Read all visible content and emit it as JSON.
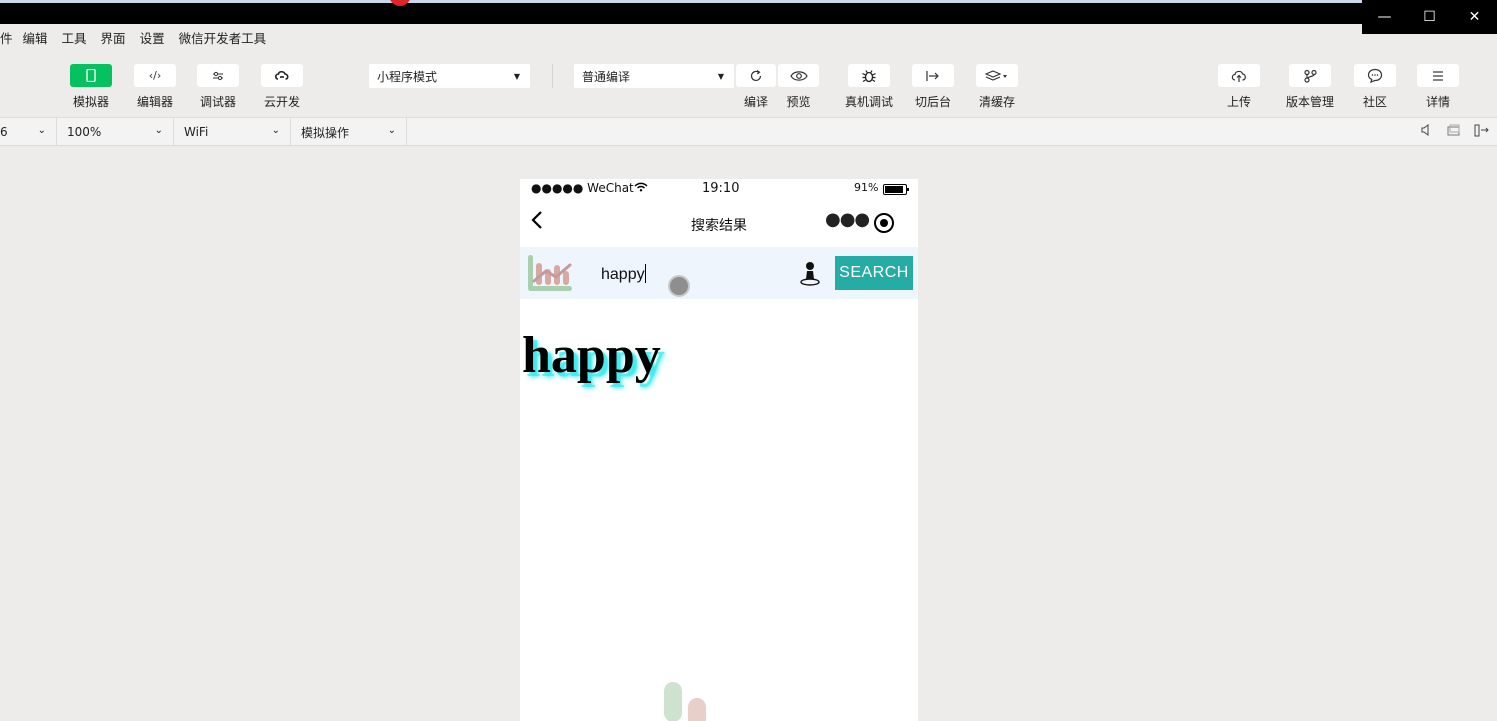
{
  "window": {
    "minimize_glyph": "—",
    "maximize_glyph": "☐",
    "close_glyph": "✕"
  },
  "menu": [
    "件",
    "编辑",
    "工具",
    "界面",
    "设置",
    "微信开发者工具"
  ],
  "toolbar": {
    "simulator": "模拟器",
    "editor": "编辑器",
    "debugger": "调试器",
    "cloud": "云开发",
    "mode_select": "小程序模式",
    "compile_select": "普通编译",
    "compile": "编译",
    "preview": "预览",
    "remote_debug": "真机调试",
    "background": "切后台",
    "clear_cache": "清缓存",
    "upload": "上传",
    "version": "版本管理",
    "community": "社区",
    "details": "详情",
    "editor_glyph": "‹/›"
  },
  "subbar": {
    "device": "6",
    "zoom": "100%",
    "network": "WiFi",
    "simulate_ops": "模拟操作"
  },
  "phone": {
    "carrier": "●●●●● WeChat",
    "time": "19:10",
    "battery_pct": "91%",
    "battery_level": 0.91,
    "nav_title": "搜索结果",
    "search_text": "happy",
    "search_button": "SEARCH",
    "result_word": "happy"
  },
  "colors": {
    "accent_green": "#07c160",
    "search_button_bg": "#25aca4",
    "searchbar_bg": "#eef5fc",
    "result_shadow": "#3fe9ef"
  }
}
